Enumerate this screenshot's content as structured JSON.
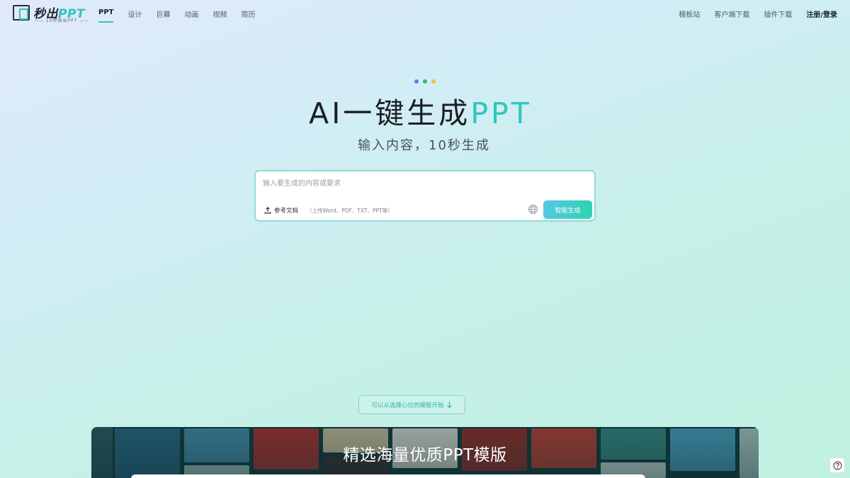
{
  "header": {
    "logo_title_main": "秒出",
    "logo_title_accent": "PPT",
    "logo_subtitle": "—— 10秒做出PPT ——",
    "nav": [
      {
        "label": "PPT",
        "active": true
      },
      {
        "label": "设计",
        "active": false
      },
      {
        "label": "巨幕",
        "active": false
      },
      {
        "label": "动画",
        "active": false
      },
      {
        "label": "视频",
        "active": false
      },
      {
        "label": "简历",
        "active": false
      }
    ],
    "right_nav": [
      {
        "label": "模板站"
      },
      {
        "label": "客户端下载"
      },
      {
        "label": "插件下载"
      },
      {
        "label": "注册/登录"
      }
    ]
  },
  "hero": {
    "dot_colors": [
      "#4e86f0",
      "#3ab56a",
      "#f1c232"
    ],
    "title_main": "AI一键生成",
    "title_accent": "PPT",
    "subtitle": "输入内容，10秒生成"
  },
  "input_box": {
    "placeholder": "输入要生成的内容或要求",
    "value": "",
    "upload_label": "参考文档",
    "upload_hint": "（上传Word、PDF、TXT、PPT等）",
    "generate_label": "智能生成"
  },
  "template_hint": "可以从选择心仪的模板开始",
  "banner": {
    "title": "精选海量优质PPT模版"
  },
  "colors": {
    "accent": "#2fc6bd",
    "generate_gradient_start": "#55c7e6",
    "generate_gradient_end": "#2fd3b1"
  },
  "icons": {
    "upload": "upload-icon",
    "globe": "globe-icon",
    "arrow": "arrow-down-icon",
    "help": "help-icon"
  }
}
